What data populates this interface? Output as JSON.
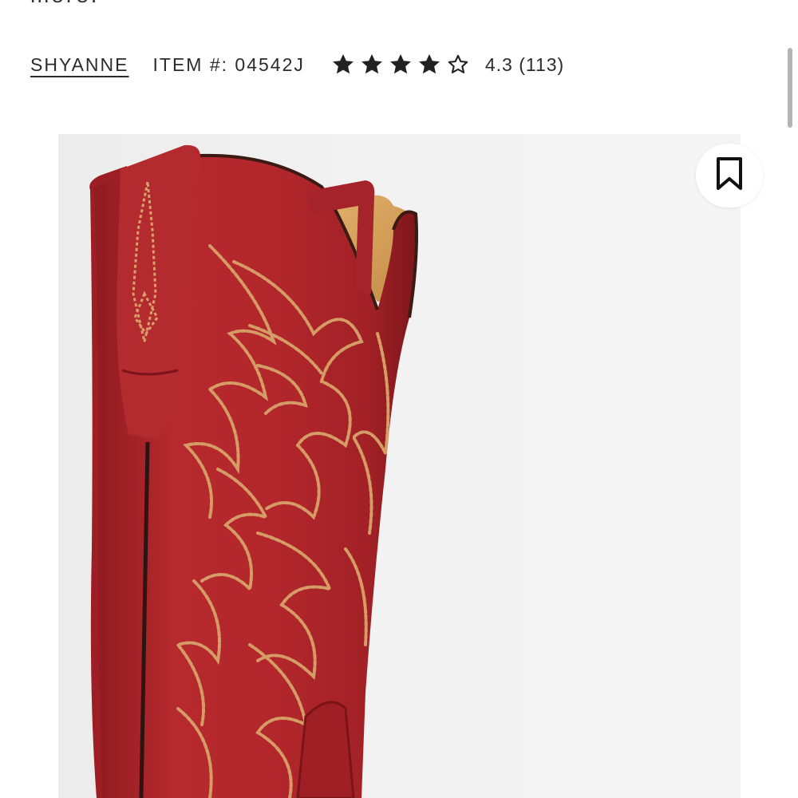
{
  "description_tail": "more.",
  "product_meta": {
    "brand": "SHYANNE",
    "item_number": "ITEM #: 04542J",
    "rating_value": 4.3,
    "rating_text": "4.3 (113)",
    "stars": [
      "star-filled-icon",
      "star-filled-icon",
      "star-filled-icon",
      "star-filled-icon",
      "star-outline-icon"
    ]
  },
  "image": {
    "subject": "red-cowboy-boot-icon",
    "bookmark_icon": "bookmark-icon"
  },
  "colors": {
    "text": "#2b2b2b",
    "star": "#222222",
    "boot_red": "#b5242a",
    "stitching": "#d9a06a",
    "lining": "#d6a35c",
    "image_bg": "#f0f0f0"
  }
}
